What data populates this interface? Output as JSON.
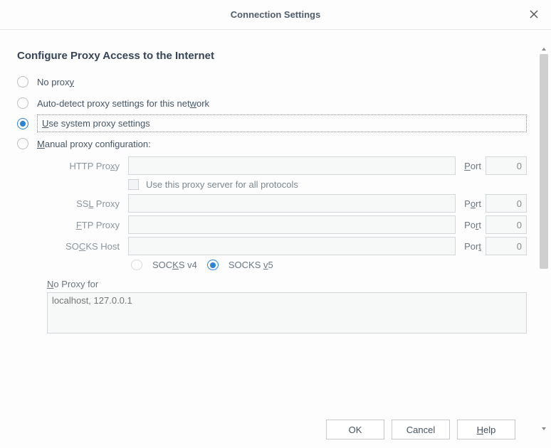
{
  "dialog": {
    "title": "Connection Settings"
  },
  "section_heading": "Configure Proxy Access to the Internet",
  "proxy_mode": {
    "no_proxy": "No proxy",
    "auto_detect": "Auto-detect proxy settings for this network",
    "system": "Use system proxy settings",
    "manual": "Manual proxy configuration:",
    "selected": "system"
  },
  "fields": {
    "http_label": "HTTP Proxy",
    "http_value": "",
    "ssl_label": "SSL Proxy",
    "ssl_value": "",
    "ftp_label": "FTP Proxy",
    "ftp_value": "",
    "socks_label": "SOCKS Host",
    "socks_value": "",
    "port_label": "Port",
    "port_http": "0",
    "port_ssl": "0",
    "port_ftp": "0",
    "port_socks": "0"
  },
  "use_for_all": {
    "label": "Use this proxy server for all protocols",
    "checked": false
  },
  "socks_version": {
    "v4_label": "SOCKS v4",
    "v5_label": "SOCKS v5",
    "selected": "v5"
  },
  "no_proxy_for": {
    "label": "No Proxy for",
    "placeholder": "localhost, 127.0.0.1",
    "value": ""
  },
  "buttons": {
    "ok": "OK",
    "cancel": "Cancel",
    "help": "Help"
  }
}
